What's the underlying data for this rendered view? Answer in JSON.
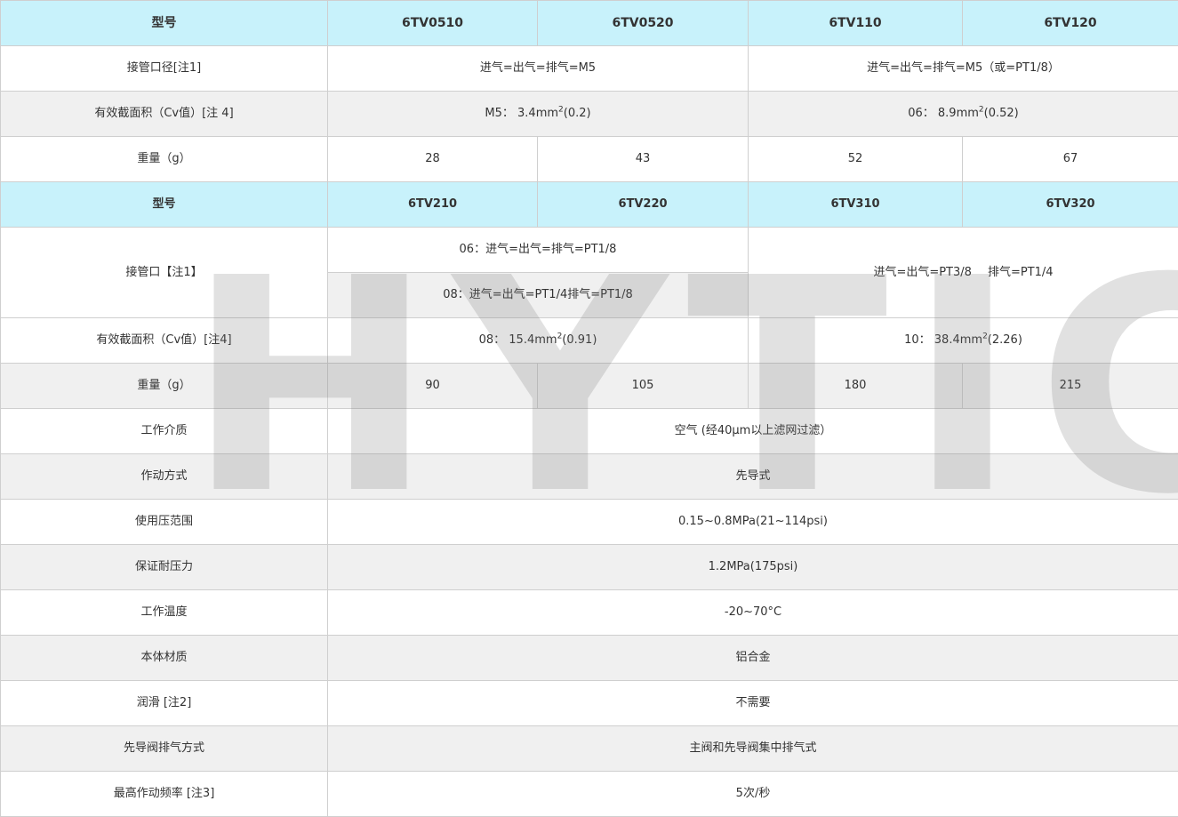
{
  "table": {
    "header1": {
      "model_label": "型号",
      "m1": "6TV0510",
      "m2": "6TV0520",
      "m3": "6TV110",
      "m4": "6TV120"
    },
    "port1": {
      "label": "接管口径[注1]",
      "left": "进气=出气=排气=M5",
      "right": "进气=出气=排气=M5（或=PT1/8）"
    },
    "area1": {
      "label": "有效截面积（Cv值）[注 4]",
      "left_pre": "M5： 3.4mm",
      "left_sup": "2",
      "left_post": "(0.2)",
      "right_pre": "06： 8.9mm",
      "right_sup": "2",
      "right_post": "(0.52)"
    },
    "weight1": {
      "label": "重量（g）",
      "v1": "28",
      "v2": "43",
      "v3": "52",
      "v4": "67"
    },
    "header2": {
      "model_label": "型号",
      "m1": "6TV210",
      "m2": "6TV220",
      "m3": "6TV310",
      "m4": "6TV320"
    },
    "port2": {
      "label": "接管口【注1】",
      "left_top": "06：进气=出气=排气=PT1/8",
      "left_bottom": "08：进气=出气=PT1/4排气=PT1/8",
      "right_a": "进气=出气=PT3/8",
      "right_b": "排气=PT1/4"
    },
    "area2": {
      "label": "有效截面积（Cv值）[注4]",
      "left_pre": "08： 15.4mm",
      "left_sup": "2",
      "left_post": "(0.91)",
      "right_pre": "10： 38.4mm",
      "right_sup": "2",
      "right_post": "(2.26)"
    },
    "weight2": {
      "label": "重量（g）",
      "v1": "90",
      "v2": "105",
      "v3": "180",
      "v4": "215"
    },
    "common": [
      {
        "label": "工作介质",
        "value": "空气 (经40μm以上滤网过滤）"
      },
      {
        "label": "作动方式",
        "value": "先导式"
      },
      {
        "label": "使用压范围",
        "value": "0.15~0.8MPa(21~114psi)"
      },
      {
        "label": "保证耐压力",
        "value": "1.2MPa(175psi)"
      },
      {
        "label": "工作温度",
        "value": "-20~70°C"
      },
      {
        "label": "本体材质",
        "value": "铝合金"
      },
      {
        "label": "润滑 [注2]",
        "value": "不需要"
      },
      {
        "label": "先导阀排气方式",
        "value": "主阀和先导阀集中排气式"
      },
      {
        "label": "最高作动频率 [注3]",
        "value": "5次/秒"
      }
    ]
  },
  "watermark": "HYTIC",
  "colors": {
    "header_bg": "#c8f2fb",
    "stripe_bg": "#f0f0f0",
    "border": "#cfcfcf",
    "text": "#333333"
  }
}
